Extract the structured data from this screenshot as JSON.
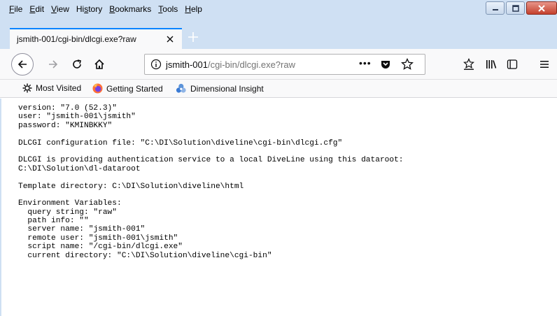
{
  "menu": [
    {
      "underline": "F",
      "rest": "ile"
    },
    {
      "underline": "E",
      "rest": "dit"
    },
    {
      "underline": "V",
      "rest": "iew"
    },
    {
      "pre": "Hi",
      "underline": "s",
      "rest": "tory"
    },
    {
      "underline": "B",
      "rest": "ookmarks"
    },
    {
      "underline": "T",
      "rest": "ools"
    },
    {
      "underline": "H",
      "rest": "elp"
    }
  ],
  "tab": {
    "title": "jsmith-001/cgi-bin/dlcgi.exe?raw"
  },
  "url": {
    "host": "jsmith-001",
    "path": "/cgi-bin/dlcgi.exe?raw",
    "more": "•••"
  },
  "bookmarks": {
    "most_visited": "Most Visited",
    "getting_started": "Getting Started",
    "dimensional_insight": "Dimensional Insight"
  },
  "content": {
    "lines": [
      "version: \"7.0 (52.3)\"",
      "user: \"jsmith-001\\jsmith\"",
      "password: \"KMINBKKY\"",
      "",
      "DLCGI configuration file: \"C:\\DI\\Solution\\diveline\\cgi-bin\\dlcgi.cfg\"",
      "",
      "DLCGI is providing authentication service to a local DiveLine using this dataroot:",
      "C:\\DI\\Solution\\dl-dataroot",
      "",
      "Template directory: C:\\DI\\Solution\\diveline\\html",
      "",
      "Environment Variables:",
      "  query string: \"raw\"",
      "  path info: \"\"",
      "  server name: \"jsmith-001\"",
      "  remote user: \"jsmith-001\\jsmith\"",
      "  script name: \"/cgi-bin/dlcgi.exe\"",
      "  current directory: \"C:\\DI\\Solution\\diveline\\cgi-bin\""
    ]
  },
  "colors": {
    "chrome": "#cfe0f3",
    "toolbar": "#f9f9fa",
    "tab_accent": "#0a84ff",
    "close_button": "#c4402d"
  }
}
